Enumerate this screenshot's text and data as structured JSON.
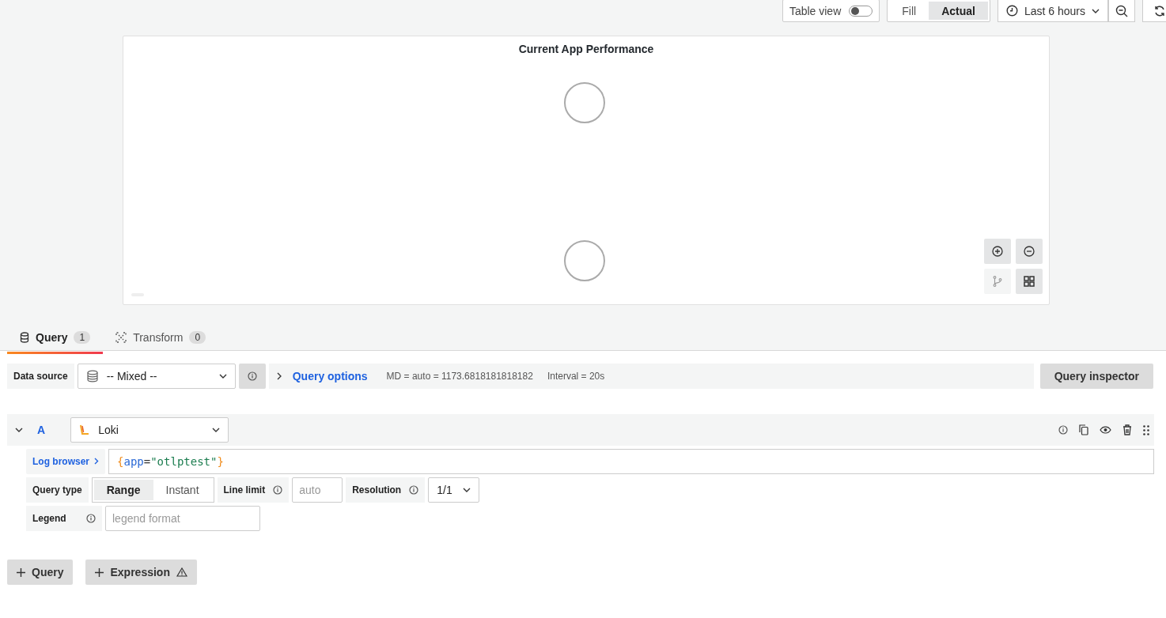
{
  "toolbar": {
    "table_view": {
      "label": "Table view",
      "on": false
    },
    "view_modes": [
      {
        "label": "Fill",
        "selected": false
      },
      {
        "label": "Actual",
        "selected": true
      }
    ],
    "time_range": "Last 6 hours"
  },
  "panel": {
    "title": "Current App Performance",
    "layouts": [
      {
        "kind": "graph",
        "selected": false
      },
      {
        "kind": "grid",
        "selected": true
      }
    ]
  },
  "tabs": [
    {
      "label": "Query",
      "count": "1",
      "selected": true
    },
    {
      "label": "Transform",
      "count": "0",
      "selected": false
    }
  ],
  "data_source": {
    "label": "Data source",
    "value": "-- Mixed --"
  },
  "query_options": {
    "label": "Query options",
    "md": "MD = auto = 1173.6818181818182",
    "interval": "Interval = 20s"
  },
  "query_inspector": "Query inspector",
  "query": {
    "ref": "A",
    "expanded": true,
    "datasource": "Loki",
    "log_browser": "Log browser",
    "expression": [
      {
        "text": "{",
        "kind": "brace"
      },
      {
        "text": "app",
        "kind": "label"
      },
      {
        "text": "=",
        "kind": "operator"
      },
      {
        "text": "\"otlptest\"",
        "kind": "string"
      },
      {
        "text": "}",
        "kind": "brace"
      }
    ],
    "query_type": {
      "label": "Query type",
      "options": [
        {
          "label": "Range",
          "selected": true
        },
        {
          "label": "Instant",
          "selected": false
        }
      ]
    },
    "line_limit": {
      "label": "Line limit",
      "placeholder": "auto"
    },
    "resolution": {
      "label": "Resolution",
      "value": "1/1"
    },
    "legend": {
      "label": "Legend",
      "placeholder": "legend format"
    }
  },
  "buttons": [
    {
      "label": "Query",
      "kind": "plain"
    },
    {
      "label": "Expression",
      "kind": "warning"
    }
  ]
}
